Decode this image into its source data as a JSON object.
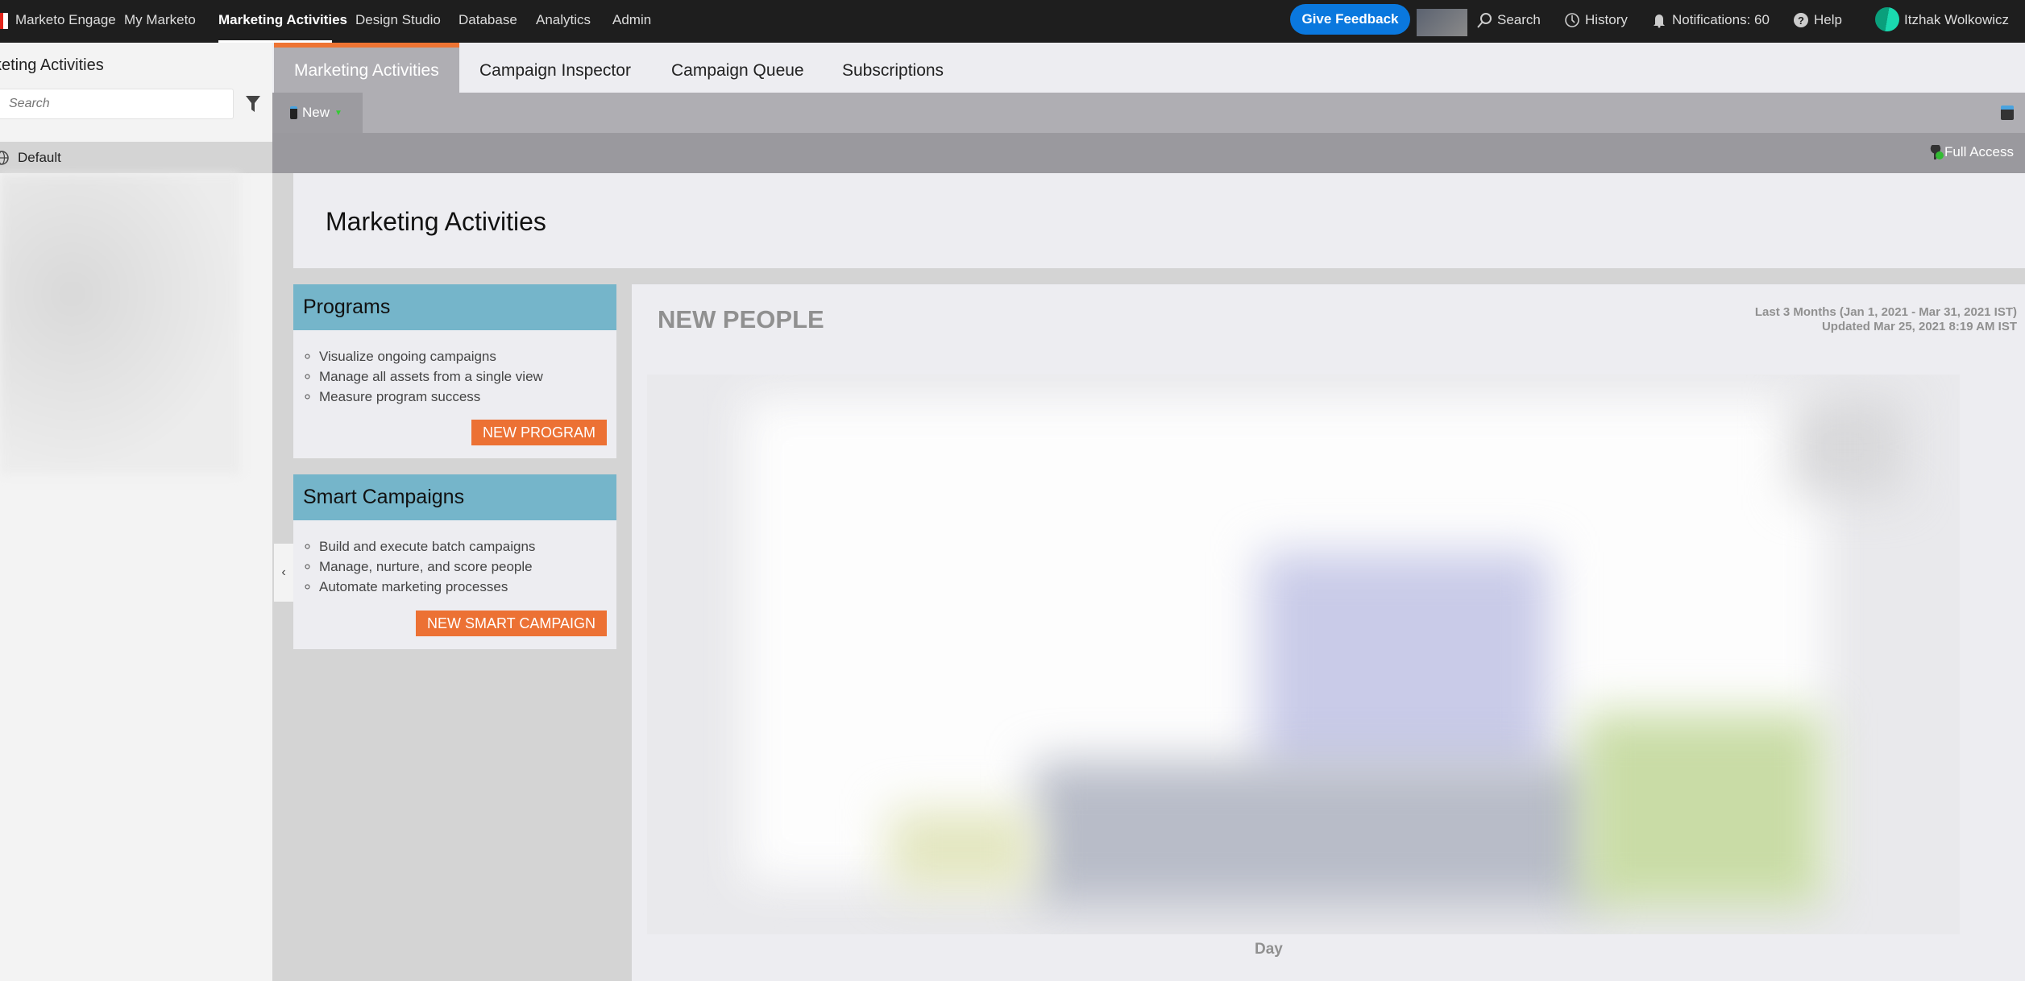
{
  "topbar": {
    "brand": "Marketo Engage",
    "nav": [
      "My Marketo",
      "Marketing Activities",
      "Design Studio",
      "Database",
      "Analytics",
      "Admin"
    ],
    "active_nav": "Marketing Activities",
    "feedback": "Give Feedback",
    "search": "Search",
    "history": "History",
    "notifications": "Notifications: 60",
    "help": "Help",
    "user": "Itzhak Wolkowicz"
  },
  "sidebar": {
    "title": "keting Activities",
    "search_placeholder": "Search",
    "default_item": "Default"
  },
  "tabs": [
    "Marketing Activities",
    "Campaign Inspector",
    "Campaign Queue",
    "Subscriptions"
  ],
  "subtab": {
    "label": "New"
  },
  "access": "Full Access",
  "header": {
    "title": "Marketing Activities"
  },
  "cards": [
    {
      "title": "Programs",
      "items": [
        "Visualize ongoing campaigns",
        "Manage all assets from a single view",
        "Measure program success"
      ],
      "button": "NEW PROGRAM"
    },
    {
      "title": "Smart Campaigns",
      "items": [
        "Build and execute batch campaigns",
        "Manage, nurture, and score people",
        "Automate marketing processes"
      ],
      "button": "NEW SMART CAMPAIGN"
    }
  ],
  "collapse_icon": "‹",
  "chart": {
    "title": "NEW PEOPLE",
    "range": "Last 3 Months (Jan 1, 2021 - Mar 31, 2021 IST)",
    "updated": "Updated Mar 25, 2021 8:19 AM IST",
    "xlabel": "Day"
  },
  "colors": {
    "accent": "#ee7433",
    "card_header": "#75b5ca",
    "feedback": "#0a78de"
  }
}
